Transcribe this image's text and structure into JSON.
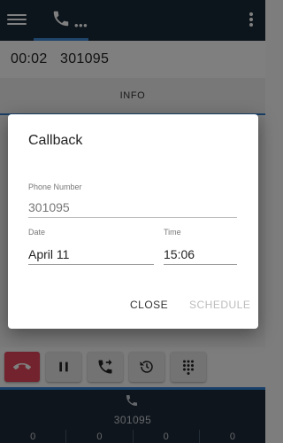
{
  "call": {
    "timer": "00:02",
    "number": "301095"
  },
  "tabs": {
    "info_label": "INFO"
  },
  "bottom": {
    "number": "301095",
    "counters": [
      "0",
      "0",
      "0",
      "0"
    ]
  },
  "dialog": {
    "title": "Callback",
    "phone_label": "Phone Number",
    "phone_value": "301095",
    "date_label": "Date",
    "date_value": "April 11",
    "time_label": "Time",
    "time_value": "15:06",
    "close_label": "CLOSE",
    "schedule_label": "SCHEDULE"
  },
  "colors": {
    "topbar": "#1b2a38",
    "accent": "#2f7fcf",
    "hangup": "#e7475a",
    "bottom_bar": "#1e2b39"
  },
  "icons": [
    "menu-icon",
    "phone-icon",
    "more-vert-icon",
    "hangup-icon",
    "pause-icon",
    "transfer-icon",
    "history-icon",
    "dialpad-icon"
  ]
}
